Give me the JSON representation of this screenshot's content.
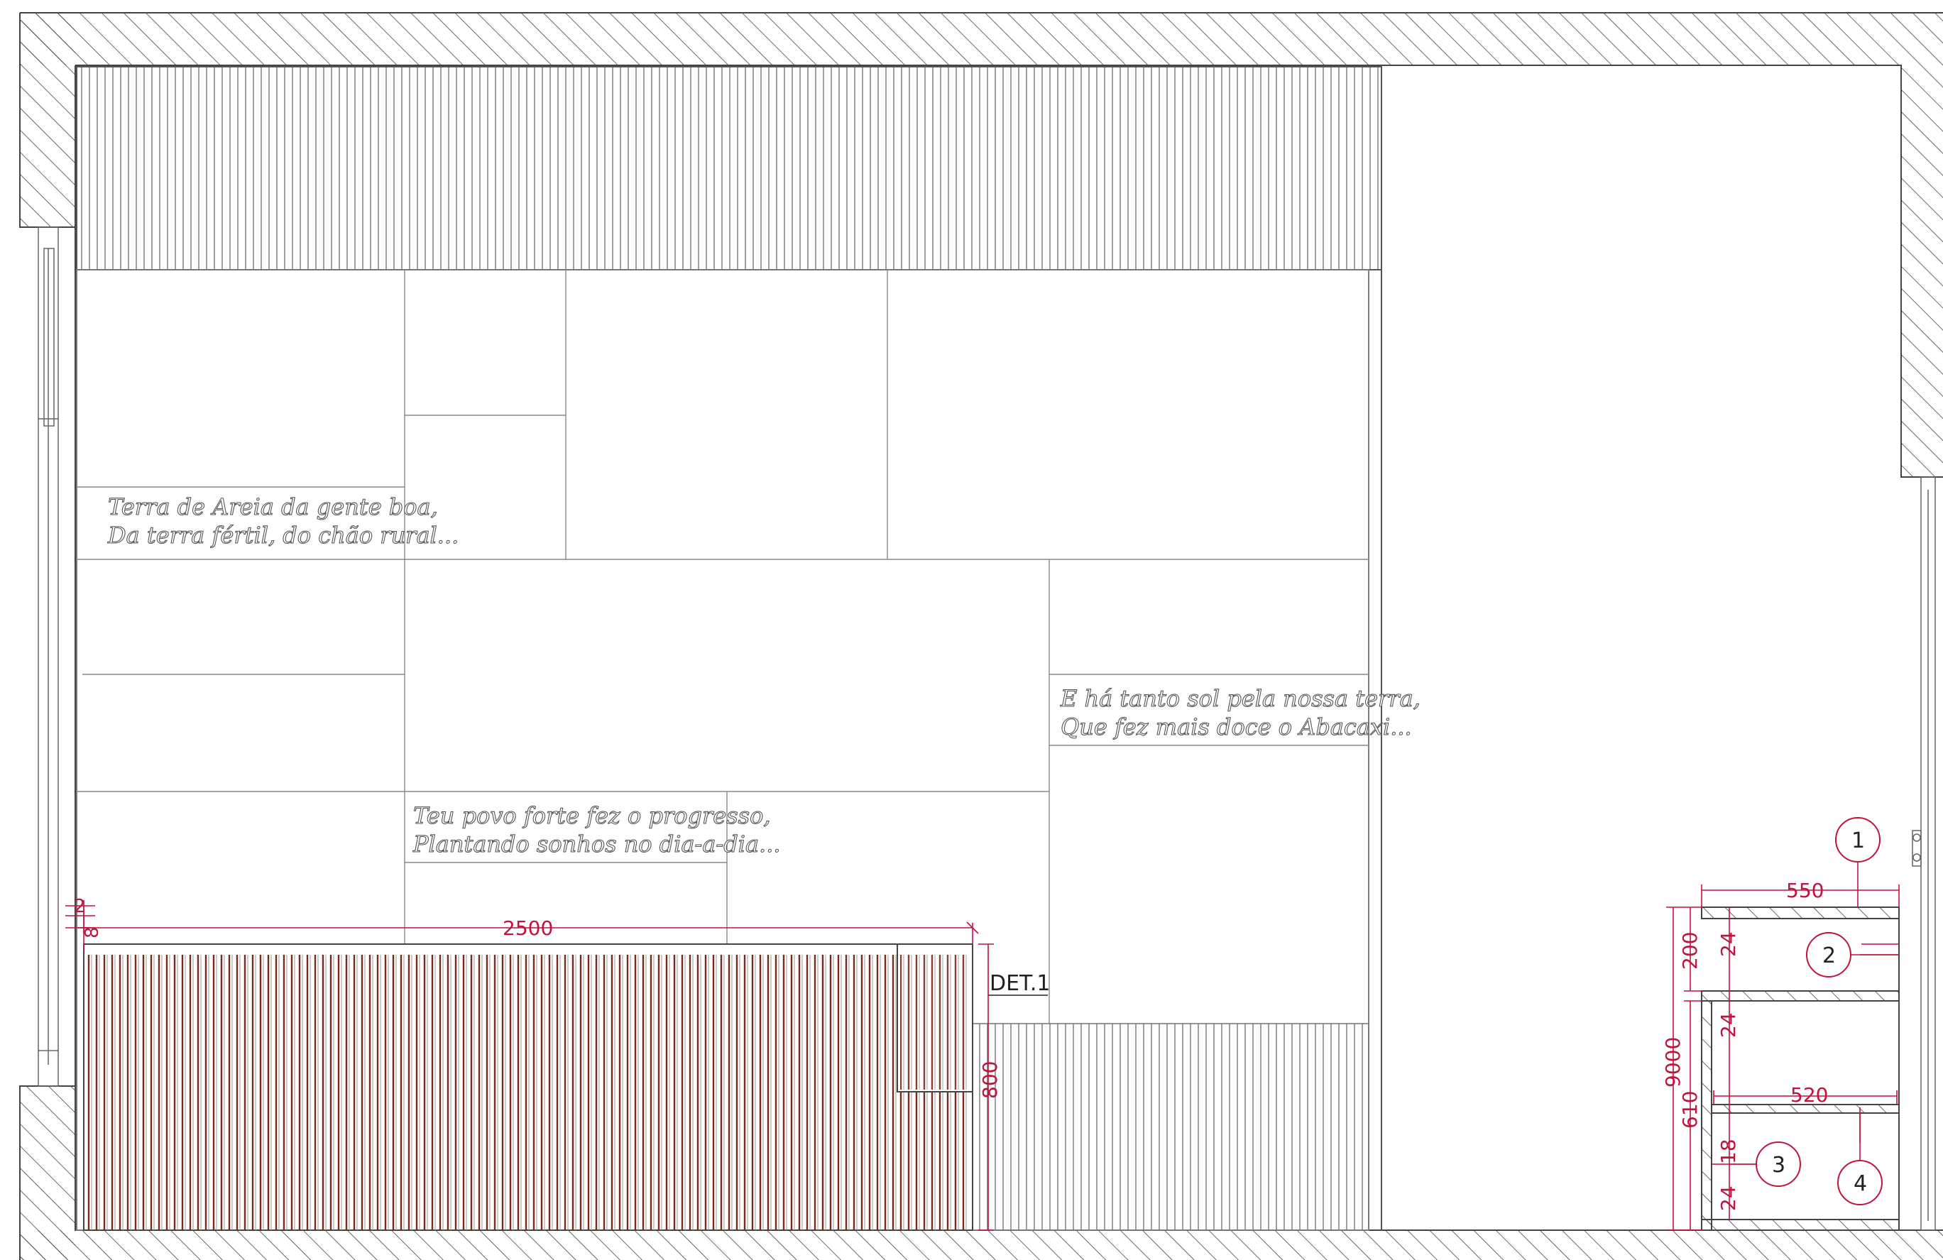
{
  "colors": {
    "line": "#555555",
    "dimension": "#c0143c",
    "slat_dark": "#7a2a1a",
    "background": "#ffffff"
  },
  "verses": {
    "verse_1": {
      "line_1": "Terra de Areia da gente boa,",
      "line_2": "Da terra fértil, do chão rural..."
    },
    "verse_2": {
      "line_1": "E há tanto sol pela nossa terra,",
      "line_2": "Que fez mais doce o Abacaxi..."
    },
    "verse_3": {
      "line_1": "Teu povo forte fez o progresso,",
      "line_2": "Plantando sonhos no dia-a-dia..."
    }
  },
  "detail_label": "DET.1",
  "dimensions": {
    "bench_length": "2500",
    "bench_height": "800",
    "top_gap_a": "2",
    "top_gap_b": "8",
    "cabinet_width": "550",
    "shelf_width": "520",
    "upper_height": "200",
    "lower_height": "610",
    "total_height": "9000",
    "board_top": "24",
    "board_mid": "24",
    "board_bottom": "24",
    "shelf_thickness": "18"
  },
  "callouts": {
    "c1": "1",
    "c2": "2",
    "c3": "3",
    "c4": "4"
  }
}
